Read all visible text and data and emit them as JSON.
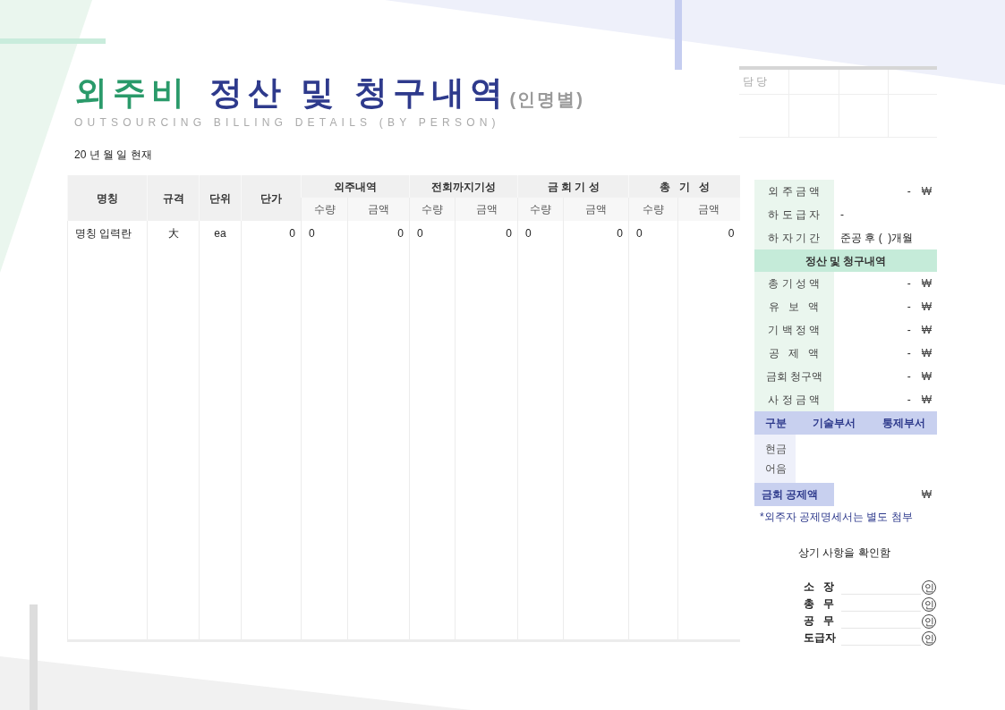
{
  "title": {
    "lead": "외주비",
    "main": "정산 및 청구내역",
    "suffix": "(인명별)"
  },
  "subtitle": "OUTSOURCING BILLING DETAILS (BY PERSON)",
  "date_line": "20 년 월 일 현재",
  "approval": {
    "label": "담 당"
  },
  "table": {
    "group_headers": [
      "외주내역",
      "전회까지기성",
      "금 회 기 성",
      "총   기   성"
    ],
    "columns": [
      "명칭",
      "규격",
      "단위",
      "단가",
      "수량",
      "금액",
      "수량",
      "금액",
      "수량",
      "금액",
      "수량",
      "금액"
    ],
    "rows": [
      [
        "명칭 입력란",
        "大",
        "ea",
        "0",
        "0",
        "0",
        "0",
        "0",
        "0",
        "0",
        "0",
        "0"
      ]
    ]
  },
  "summary": {
    "info": [
      {
        "label": "외 주 금 액",
        "value": "-",
        "currency": "₩"
      },
      {
        "label": "하 도 급 자",
        "value": "-"
      },
      {
        "label": "하 자 기 간",
        "value": "준공 후 (  )개월"
      }
    ],
    "section_title": "정산 및 청구내역",
    "items": [
      {
        "label": "총 기 성 액",
        "value": "-",
        "currency": "₩"
      },
      {
        "label": "유   보   액",
        "value": "-",
        "currency": "₩"
      },
      {
        "label": "기 백 정 액",
        "value": "-",
        "currency": "₩"
      },
      {
        "label": "공   제   액",
        "value": "-",
        "currency": "₩"
      },
      {
        "label": "금회 청구액",
        "value": "-",
        "currency": "₩"
      },
      {
        "label": "사 정 금 액",
        "value": "-",
        "currency": "₩"
      }
    ],
    "dept_header": [
      "구분",
      "기술부서",
      "통제부서"
    ],
    "payment_labels": [
      "현금",
      "어음"
    ],
    "deduction": {
      "label": "금회 공제액",
      "currency": "₩"
    },
    "note": "*외주자 공제명세서는 별도 첨부"
  },
  "confirm": "상기 사항을 확인함",
  "signatures": [
    {
      "label": "소   장",
      "seal": "인"
    },
    {
      "label": "총   무",
      "seal": "인"
    },
    {
      "label": "공   무",
      "seal": "인"
    },
    {
      "label": "도급자",
      "seal": "인"
    }
  ]
}
